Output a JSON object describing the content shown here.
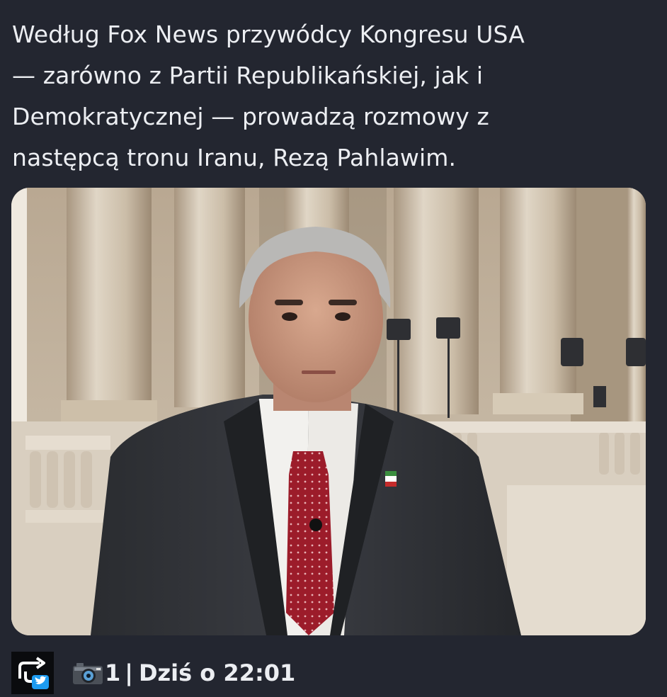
{
  "post": {
    "text_lines": [
      "Według Fox News przywódcy Kongresu USA",
      "— zarówno z Partii Republikańskiej, jak i",
      "Demokratycznej — prowadzą rozmowy z",
      "następcą tronu Iranu, Rezą Pahlawim."
    ]
  },
  "footer": {
    "source_icon": "retweet-twitter-icon",
    "media_icon": "camera-icon",
    "media_count": "1",
    "separator": "|",
    "timestamp": "Dziś o 22:01"
  },
  "colors": {
    "background": "#232630",
    "text": "#eceef2",
    "twitter_blue": "#1d9bf0"
  }
}
